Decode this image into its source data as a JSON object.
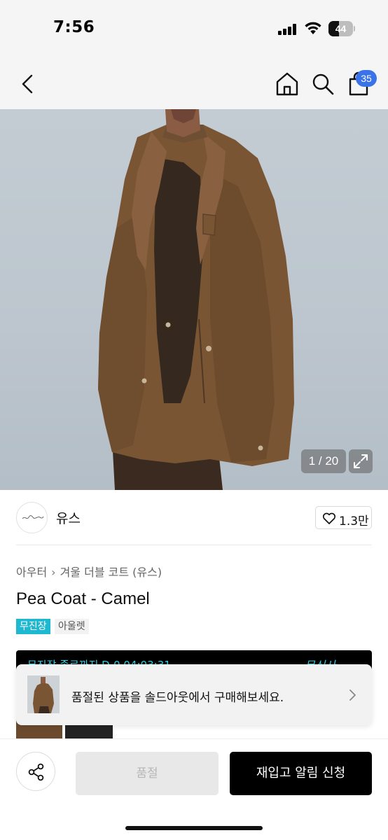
{
  "status_bar": {
    "time": "7:56",
    "battery": "44",
    "battery_level": 0.44
  },
  "nav": {
    "cart_count": "35",
    "accent_color": "#3a73e8"
  },
  "gallery": {
    "counter": "1 / 20"
  },
  "brand": {
    "name": "유스",
    "likes": "1.3만"
  },
  "breadcrumb": [
    "아우터",
    "겨울 더블 코트 (유스)"
  ],
  "product": {
    "title": "Pea Coat - Camel",
    "tag_primary": "무진장",
    "tag_secondary": "아울렛",
    "tag_color": "#1fb8d1"
  },
  "promo": {
    "text": "무진장 종료까지 D-0 04:03:31",
    "brand": "무신사"
  },
  "soldout_card": {
    "text": "품절된 상품을 솔드아웃에서 구매해보세요."
  },
  "actions": {
    "soldout_label": "품절",
    "restock_label": "재입고 알림 신청"
  },
  "icons": [
    "back-icon",
    "home-icon",
    "search-icon",
    "cart-icon",
    "expand-icon",
    "heart-icon",
    "chevron-right-icon",
    "share-icon"
  ]
}
